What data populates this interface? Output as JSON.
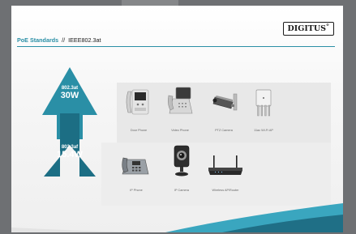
{
  "title": {
    "brand": "PoE Standards",
    "separator": "//",
    "standard": "IEEE802.3at"
  },
  "logo": {
    "text": "DIGITUS",
    "mark": "®"
  },
  "tiers": [
    {
      "standard": "802.3at",
      "power": "30W",
      "color": "#2a8fa6"
    },
    {
      "standard": "802.3af",
      "power": "15.4W",
      "color": "#1c6e84"
    }
  ],
  "devices_top": [
    {
      "label": "Door Phone",
      "icon": "door-phone-icon"
    },
    {
      "label": "Video Phone",
      "icon": "video-phone-icon"
    },
    {
      "label": "PTZ Camera",
      "icon": "ptz-camera-icon"
    },
    {
      "label": "11ac Wi-Fi AP",
      "icon": "wifi-ap-icon"
    }
  ],
  "devices_bottom": [
    {
      "label": "IP Phone",
      "icon": "ip-phone-icon"
    },
    {
      "label": "IP Camera",
      "icon": "ip-camera-icon"
    },
    {
      "label": "Wireless AP/Router",
      "icon": "wireless-router-icon"
    }
  ],
  "colors": {
    "accent": "#2a8fa6",
    "accent_dark": "#1c6e84",
    "wave_light": "#3aa6bf",
    "wave_dark": "#1f6f86"
  }
}
